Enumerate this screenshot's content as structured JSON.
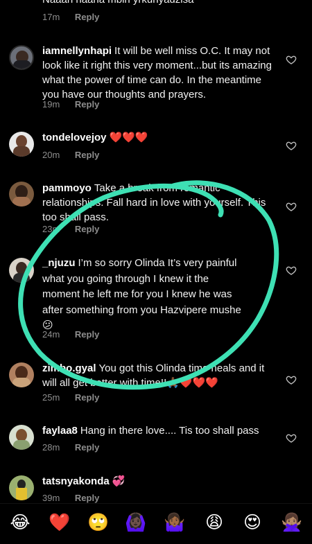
{
  "comments": [
    {
      "user": "",
      "text": "Naaan haana mbiri yrkunyadzisa",
      "time": "17m",
      "reply": "Reply"
    },
    {
      "user": "iamnellynhapi",
      "text": "It will be well miss O.C. It may not look like it right this very moment...but its amazing what the power of time can do. In the meantime you have our thoughts and prayers.",
      "time": "19m",
      "reply": "Reply"
    },
    {
      "user": "tondelovejoy",
      "text": "❤️❤️❤️",
      "time": "20m",
      "reply": "Reply"
    },
    {
      "user": "pammoyo",
      "text": "Take a break from romantic relationships. Fall hard in love with yourself. This too shall pass.",
      "time": "23m",
      "reply": "Reply"
    },
    {
      "user": "_njuzu",
      "text": "I’m so sorry Olinda It’s very painful what you going through I knew it the moment he left me for you I knew he was after something from you Hazvipere mushe😕",
      "time": "24m",
      "reply": "Reply"
    },
    {
      "user": "zimbo.gyal",
      "text": "You got this Olinda time heals and it will all get better with time!!🙏🏾❤️❤️❤️",
      "time": "25m",
      "reply": "Reply"
    },
    {
      "user": "faylaa8",
      "text": "Hang in there love.... Tis too shall pass",
      "time": "28m",
      "reply": "Reply"
    },
    {
      "user": "tatsnyakonda",
      "text": "💞",
      "time": "39m",
      "reply": "Reply"
    }
  ],
  "emoji_bar": [
    "😂",
    "❤️",
    "🙄",
    "🙆🏿‍♀️",
    "🤷🏾‍♀️",
    "😩",
    "😍",
    "🙅🏽‍♀️"
  ],
  "colors": {
    "background": "#000000",
    "meta": "#8e8e8e",
    "annotation": "#3ee0b4"
  }
}
